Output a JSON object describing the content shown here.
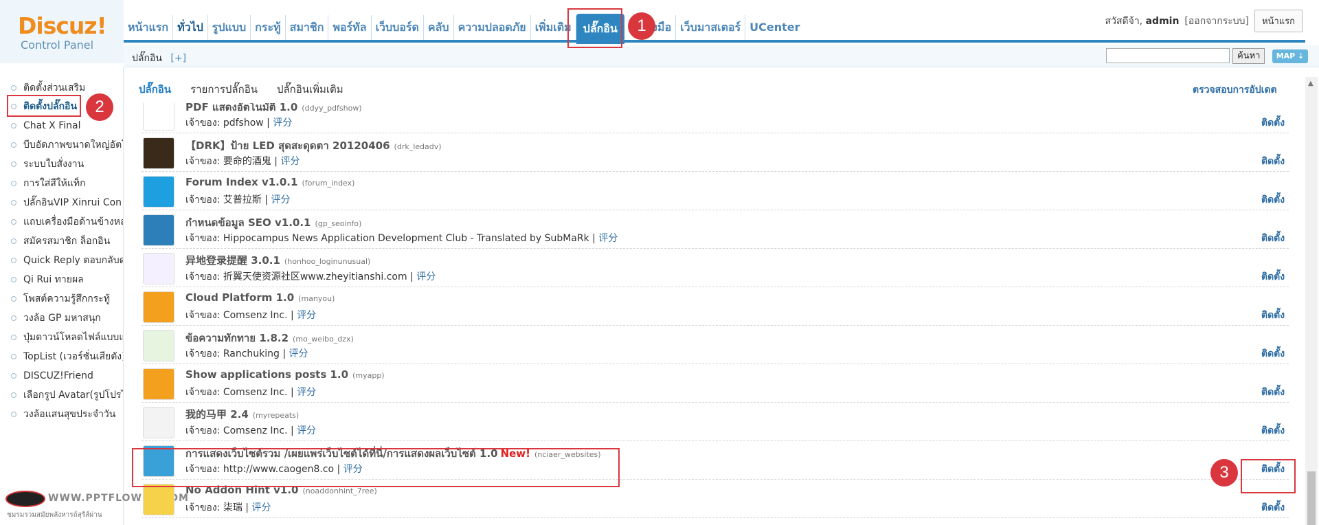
{
  "logo": {
    "brand": "Discuz!",
    "subtitle": "Control Panel"
  },
  "topnav": [
    {
      "label": "หน้าแรก"
    },
    {
      "label": "ทั่วไป"
    },
    {
      "label": "รูปแบบ"
    },
    {
      "label": "กระทู้"
    },
    {
      "label": "สมาชิก"
    },
    {
      "label": "พอร์ทัล"
    },
    {
      "label": "เว็บบอร์ด"
    },
    {
      "label": "คลับ"
    },
    {
      "label": "ความปลอดภัย"
    },
    {
      "label": "เพิ่มเติม"
    },
    {
      "label": "ปลั๊กอิน"
    },
    {
      "label": "เครื่องมือ"
    },
    {
      "label": "เว็บมาสเตอร์"
    },
    {
      "label": "UCenter"
    }
  ],
  "header": {
    "greeting": "สวัสดีจ้า,",
    "user": "admin",
    "logout": "[ออกจากระบบ]",
    "home_button": "หน้าแรก"
  },
  "subbar": {
    "crumb": "ปลั๊กอิน",
    "add": "[+]",
    "search_button": "ค้นหา",
    "map_button": "MAP ⇣"
  },
  "sidebar": [
    {
      "label": "ติดตั้งส่วนเสริม"
    },
    {
      "label": "ติดตั้งปลั๊กอิน"
    },
    {
      "label": "Chat X Final"
    },
    {
      "label": "บีบอัดภาพขนาดใหญ่อัตโน"
    },
    {
      "label": "ระบบใบสั่งงาน"
    },
    {
      "label": "การใส่สีให้แท็ก"
    },
    {
      "label": "ปลั๊กอินVIP Xinrui Con"
    },
    {
      "label": "แถบเครื่องมือด้านข้างหล"
    },
    {
      "label": "สมัครสมาชิก ล็อกอิน"
    },
    {
      "label": "Quick Reply ตอบกลับด"
    },
    {
      "label": "Qi Rui ทายผล"
    },
    {
      "label": "โพสต์ความรู้สึกกระทู้"
    },
    {
      "label": "วงล้อ GP มหาสนุก"
    },
    {
      "label": "ปุ่มดาวน์โหลดไฟล์แบบแ"
    },
    {
      "label": "TopList (เวอร์ชั่นเสียตัง)"
    },
    {
      "label": "DISCUZ!Friend"
    },
    {
      "label": "เลือกรูป Avatar(รูปโปรไ"
    },
    {
      "label": "วงล้อแสนสุขประจำวัน"
    }
  ],
  "watermark": {
    "site": "WWW.PPTFLOWER.COM",
    "tag": "ชมรมรวมสมัยพลังหารถ์สุรัส์ผ่าน"
  },
  "tabs": [
    {
      "label": "ปลั๊กอิน"
    },
    {
      "label": "รายการปลั๊กอิน"
    },
    {
      "label": "ปลั๊กอินเพิ่มเติม"
    }
  ],
  "check_update": "ตรวจสอบการอัปเดต",
  "owner_prefix": "เจ้าของ:",
  "rate_label": "评分",
  "install_label": "ติดตั้ง",
  "new_label": "New!",
  "plugins": [
    {
      "name": "PDF แสดงอัตโนมัติ 1.0",
      "id": "(ddyy_pdfshow)",
      "owner": "pdfshow",
      "icon": "pdf-icon",
      "color": "#ffffff"
    },
    {
      "name": "【DRK】ป้าย LED สุดสะดุดตา 20120406",
      "id": "(drk_ledadv)",
      "owner": "要命的酒鬼",
      "icon": "led-icon",
      "color": "#3a2a1a"
    },
    {
      "name": "Forum Index v1.0.1",
      "id": "(forum_index)",
      "owner": "艾普拉斯",
      "icon": "home-icon",
      "color": "#1ea0e0"
    },
    {
      "name": "กำหนดข้อมูล SEO v1.0.1",
      "id": "(gp_seoinfo)",
      "owner": "Hippocampus News Application Development Club - Translated by SubMaRk",
      "icon": "seo-icon",
      "color": "#2c7fb8"
    },
    {
      "name": "异地登录提醒 3.0.1",
      "id": "(honhoo_loginunusual)",
      "owner": "折翼天使资源社区www.zheyitianshi.com",
      "icon": "login-icon",
      "color": "#f4f0ff"
    },
    {
      "name": "Cloud Platform 1.0",
      "id": "(manyou)",
      "owner": "Comsenz Inc.",
      "icon": "manyou-icon",
      "color": "#f2a01e"
    },
    {
      "name": "ข้อความทักทาย 1.8.2",
      "id": "(mo_weibo_dzx)",
      "owner": "Ranchuking",
      "icon": "chat-bubble-icon",
      "color": "#e6f4e0"
    },
    {
      "name": "Show applications posts 1.0",
      "id": "(myapp)",
      "owner": "Comsenz Inc.",
      "icon": "manyou-icon",
      "color": "#f2a01e"
    },
    {
      "name": "我的马甲 2.4",
      "id": "(myrepeats)",
      "owner": "Comsenz Inc.",
      "icon": "users-icon",
      "color": "#f3f3f3"
    },
    {
      "name": "การแสดงเว็บไซต์รวม /เผยแพร่เว็บไซต์ได้ที่นี่/การแสดงผลเว็บไซต์ 1.0",
      "id": "(nciaer_websites)",
      "owner": "http://www.caogen8.co",
      "icon": "globe-icon",
      "color": "#3aa0d8",
      "is_new": true
    },
    {
      "name": "No Addon Hint v1.0",
      "id": "(noaddonhint_7ree)",
      "owner": "柒瑞",
      "icon": "7ree-icon",
      "color": "#f5d24a"
    }
  ],
  "annotations": [
    {
      "label": "1"
    },
    {
      "label": "2"
    },
    {
      "label": "3"
    }
  ],
  "colors": {
    "accent": "#2e86c1",
    "link": "#2e6da4",
    "highlight": "#d9363e",
    "logo_orange": "#f08c1e"
  }
}
